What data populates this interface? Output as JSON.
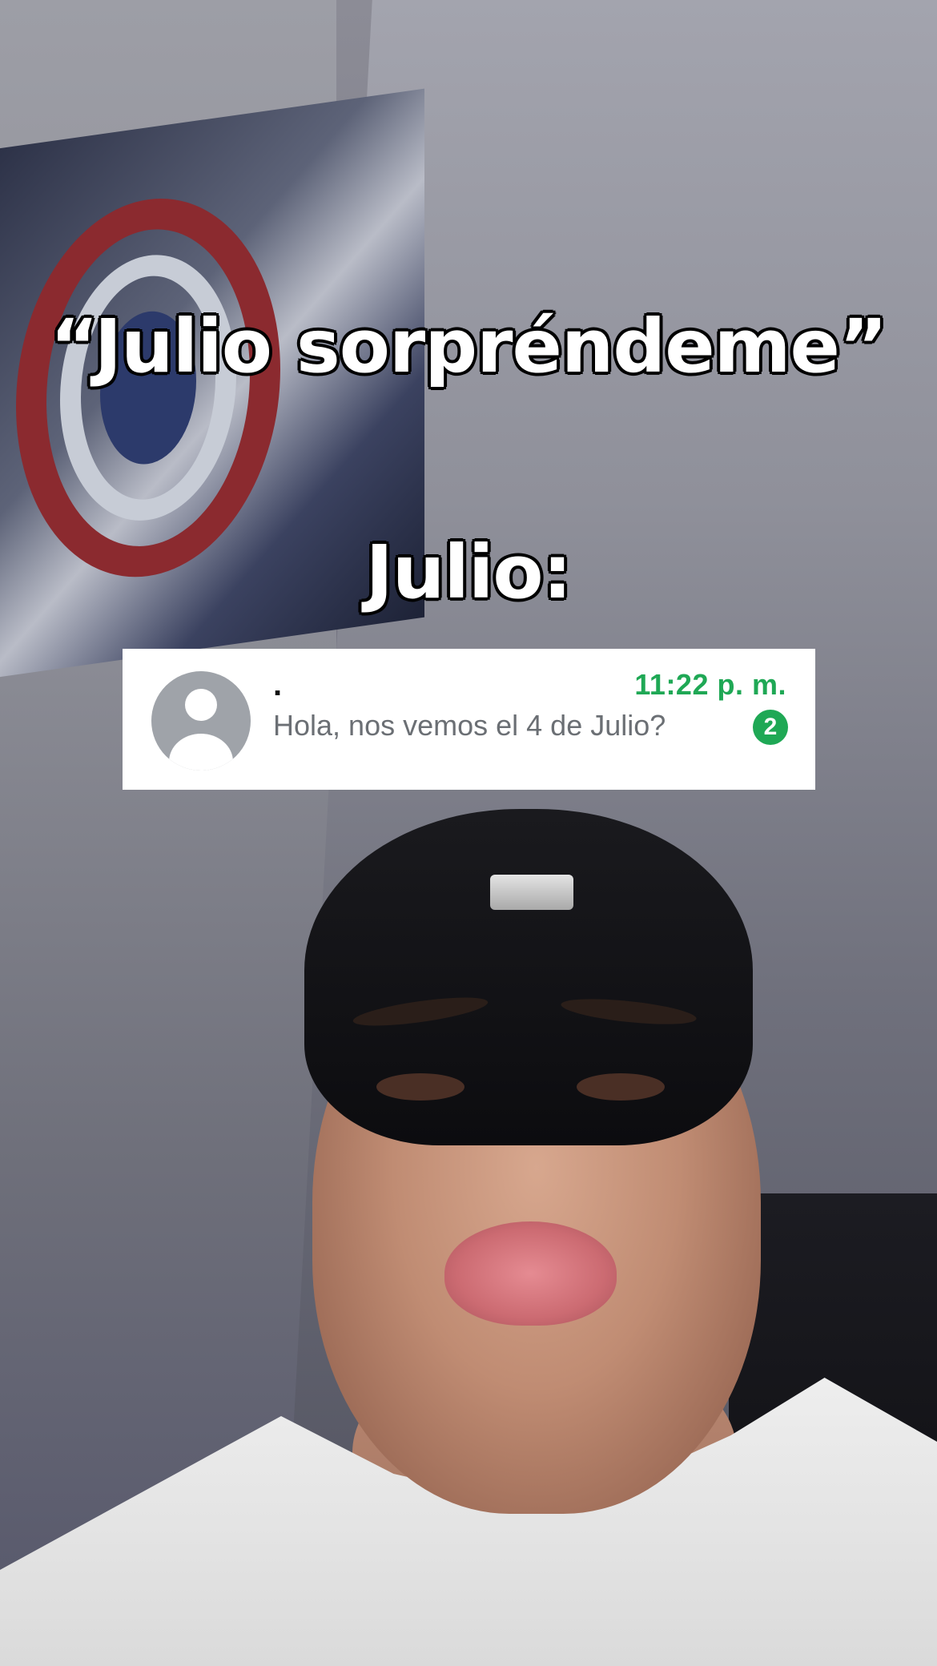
{
  "caption": {
    "top_text": "“Julio sorpréndeme”",
    "mid_text": "Julio:"
  },
  "chat_notification": {
    "contact_name": ".",
    "time": "11:22 p. m.",
    "message_preview": "Hola, nos vemos el 4 de Julio?",
    "unread_count": "2",
    "accent_color": "#1fa855",
    "avatar_icon": "default-profile-icon"
  }
}
